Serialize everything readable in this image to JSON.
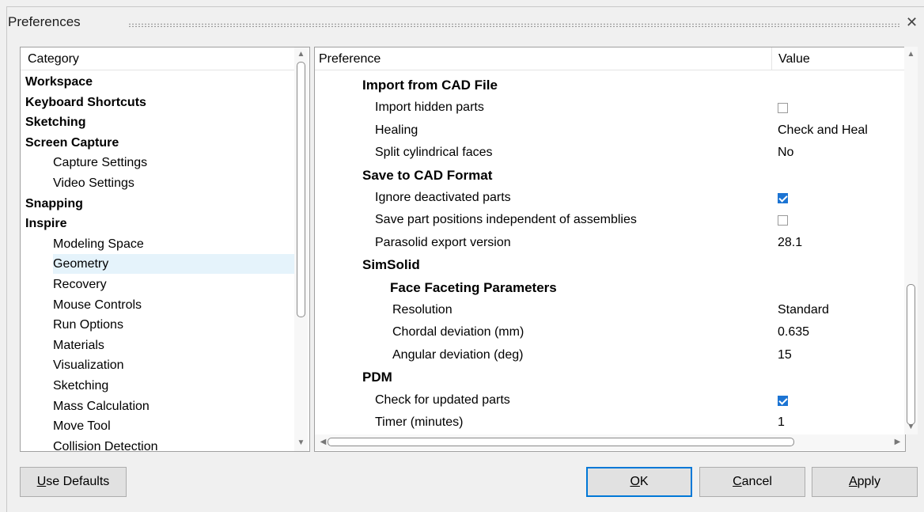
{
  "window": {
    "title": "Preferences",
    "close_glyph": "✕"
  },
  "left_panel": {
    "header": "Category",
    "items": [
      {
        "label": "Workspace",
        "level": 0
      },
      {
        "label": "Keyboard Shortcuts",
        "level": 0
      },
      {
        "label": "Sketching",
        "level": 0
      },
      {
        "label": "Screen Capture",
        "level": 0
      },
      {
        "label": "Capture Settings",
        "level": 1
      },
      {
        "label": "Video Settings",
        "level": 1
      },
      {
        "label": "Snapping",
        "level": 0
      },
      {
        "label": "Inspire",
        "level": 0
      },
      {
        "label": "Modeling Space",
        "level": 1
      },
      {
        "label": "Geometry",
        "level": 1,
        "selected": true
      },
      {
        "label": "Recovery",
        "level": 1
      },
      {
        "label": "Mouse Controls",
        "level": 1
      },
      {
        "label": "Run Options",
        "level": 1
      },
      {
        "label": "Materials",
        "level": 1
      },
      {
        "label": "Visualization",
        "level": 1
      },
      {
        "label": "Sketching",
        "level": 1
      },
      {
        "label": "Mass Calculation",
        "level": 1
      },
      {
        "label": "Move Tool",
        "level": 1
      },
      {
        "label": "Collision Detection",
        "level": 1
      }
    ]
  },
  "right_panel": {
    "col_preference": "Preference",
    "col_value": "Value",
    "rows": [
      {
        "label": "Import from CAD File",
        "type": "group",
        "indent": 1
      },
      {
        "label": "Import hidden parts",
        "type": "checkbox",
        "checked": false,
        "indent": 2
      },
      {
        "label": "Healing",
        "type": "text",
        "value": "Check and Heal",
        "indent": 2
      },
      {
        "label": "Split cylindrical faces",
        "type": "text",
        "value": "No",
        "indent": 2
      },
      {
        "label": "Save to CAD Format",
        "type": "group",
        "indent": 1
      },
      {
        "label": "Ignore deactivated parts",
        "type": "checkbox",
        "checked": true,
        "indent": 2
      },
      {
        "label": "Save part positions independent of assemblies",
        "type": "checkbox",
        "checked": false,
        "indent": 2
      },
      {
        "label": "Parasolid export version",
        "type": "text",
        "value": "28.1",
        "indent": 2
      },
      {
        "label": "SimSolid",
        "type": "group",
        "indent": 1
      },
      {
        "label": "Face Faceting Parameters",
        "type": "group",
        "indent": 2
      },
      {
        "label": "Resolution",
        "type": "text",
        "value": "Standard",
        "indent": 3
      },
      {
        "label": "Chordal deviation (mm)",
        "type": "text",
        "value": "0.635",
        "indent": 3
      },
      {
        "label": "Angular deviation (deg)",
        "type": "text",
        "value": "15",
        "indent": 3
      },
      {
        "label": "PDM",
        "type": "group",
        "indent": 1
      },
      {
        "label": "Check for updated parts",
        "type": "checkbox",
        "checked": true,
        "indent": 2
      },
      {
        "label": "Timer (minutes)",
        "type": "text",
        "value": "1",
        "indent": 2
      }
    ]
  },
  "buttons": {
    "use_defaults": {
      "mnemonic": "U",
      "rest": "se Defaults"
    },
    "ok": {
      "mnemonic": "O",
      "rest": "K"
    },
    "cancel": {
      "mnemonic": "C",
      "rest": "ancel"
    },
    "apply": {
      "mnemonic": "A",
      "rest": "pply"
    }
  }
}
